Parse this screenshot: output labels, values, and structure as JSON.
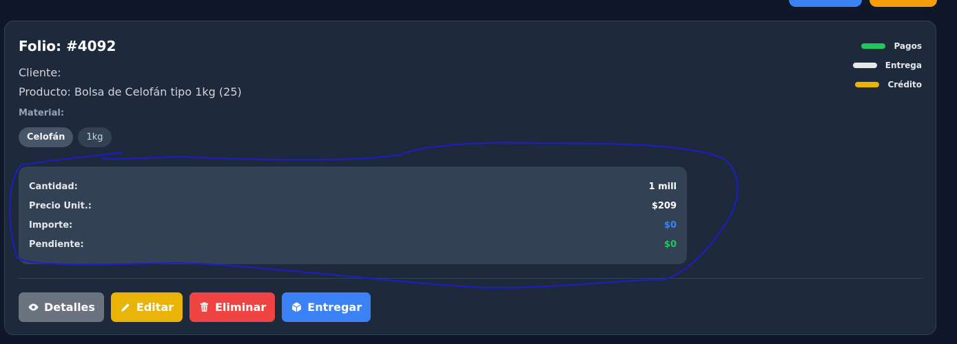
{
  "order": {
    "folio": "Folio: #4092",
    "cliente": "Cliente:",
    "producto": "Producto: Bolsa de Celofán tipo 1kg (25)",
    "material_label": "Material:",
    "tags": [
      "Celofán",
      "1kg"
    ]
  },
  "legend": [
    {
      "label": "Pagos",
      "color": "#22c55e"
    },
    {
      "label": "Entrega",
      "color": "#e5e7eb"
    },
    {
      "label": "Crédito",
      "color": "#eab308"
    }
  ],
  "summary": {
    "cantidad": {
      "label": "Cantidad:",
      "value": "1 mill",
      "color": "#ffffff"
    },
    "precio": {
      "label": "Precio Unit.:",
      "value": "$209",
      "color": "#ffffff"
    },
    "importe": {
      "label": "Importe:",
      "value": "$0",
      "color": "#3b82f6"
    },
    "pendiente": {
      "label": "Pendiente:",
      "value": "$0",
      "color": "#22c55e"
    }
  },
  "actions": {
    "detalles": {
      "label": "Detalles",
      "icon": "eye-icon",
      "color": "#6b7280"
    },
    "editar": {
      "label": "Editar",
      "icon": "pencil-icon",
      "color": "#eab308"
    },
    "eliminar": {
      "label": "Eliminar",
      "icon": "trash-icon",
      "color": "#ef4444"
    },
    "entregar": {
      "label": "Entregar",
      "icon": "box-icon",
      "color": "#3b82f6"
    }
  },
  "colors": {
    "background": "#0f1729",
    "card": "#1e293b",
    "summary_panel": "#334155",
    "annotation_stroke": "#1e1ec8"
  }
}
